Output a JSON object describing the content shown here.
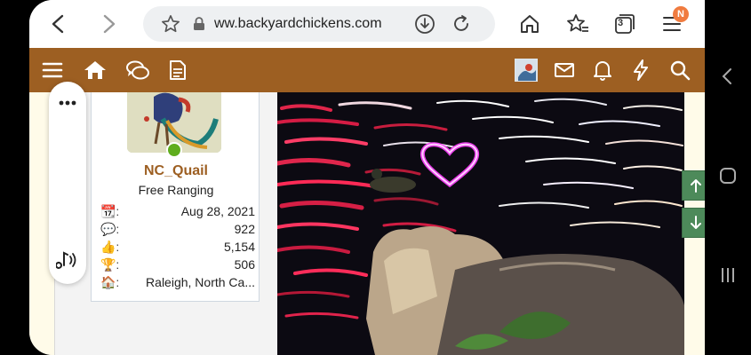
{
  "browser": {
    "url": "ww.backyardchickens.com",
    "tab_count": "3",
    "notification_badge": "N",
    "icons": [
      "back-icon",
      "forward-icon",
      "bookmark-star-icon",
      "lock-icon",
      "download-icon",
      "reload-icon",
      "home-icon",
      "favorites-icon",
      "tabs-icon",
      "menu-icon"
    ]
  },
  "site_nav": {
    "icons": [
      "hamburger-menu-icon",
      "home-icon",
      "chat-bubbles-icon",
      "document-icon",
      "envelope-icon",
      "bell-icon",
      "lightning-icon",
      "search-icon"
    ]
  },
  "user": {
    "name": "NC_Quail",
    "title": "Free Ranging",
    "stats": [
      {
        "label": "📆:",
        "value": "Aug 28, 2021"
      },
      {
        "label": "💬:",
        "value": "922"
      },
      {
        "label": "👍:",
        "value": "5,154"
      },
      {
        "label": "🏆:",
        "value": "506"
      },
      {
        "label": "🏠:",
        "value": "Raleigh, North Ca..."
      }
    ]
  },
  "colors": {
    "brand_brown": "#9d5f22",
    "online_green": "#5fad1d",
    "scroll_green": "#4d8a5a",
    "badge_orange": "#f07b3f"
  }
}
